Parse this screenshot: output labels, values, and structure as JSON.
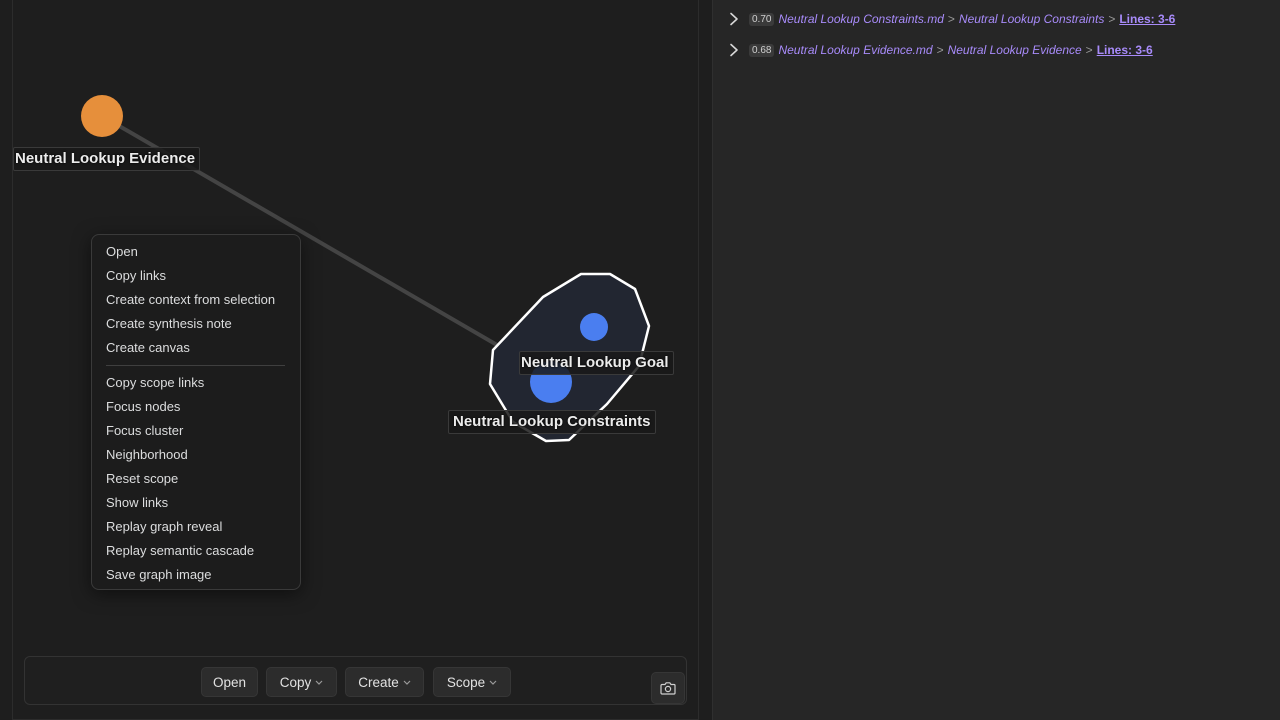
{
  "graph": {
    "nodes": [
      {
        "id": "evidence",
        "label": "Neutral Lookup Evidence",
        "color": "#e68f3b"
      },
      {
        "id": "goal",
        "label": "Neutral Lookup Goal",
        "color": "#4a7ef0"
      },
      {
        "id": "constraints",
        "label": "Neutral Lookup Constraints",
        "color": "#4a7ef0"
      }
    ]
  },
  "context_menu": {
    "group1": [
      "Open",
      "Copy links",
      "Create context from selection",
      "Create synthesis note",
      "Create canvas"
    ],
    "group2": [
      "Copy scope links",
      "Focus nodes",
      "Focus cluster",
      "Neighborhood",
      "Reset scope",
      "Show links",
      "Replay graph reveal",
      "Replay semantic cascade",
      "Save graph image"
    ]
  },
  "toolbar": {
    "open_label": "Open",
    "copy_label": "Copy",
    "create_label": "Create",
    "scope_label": "Scope",
    "camera_icon": "camera-icon"
  },
  "results": [
    {
      "score": "0.70",
      "file": "Neutral Lookup Constraints.md",
      "sep": ">",
      "heading": "Neutral Lookup Constraints",
      "lines": "Lines: 3-6"
    },
    {
      "score": "0.68",
      "file": "Neutral Lookup Evidence.md",
      "sep": ">",
      "heading": "Neutral Lookup Evidence",
      "lines": "Lines: 3-6"
    }
  ],
  "colors": {
    "accent": "#a88bfa",
    "node_orange": "#e68f3b",
    "node_blue": "#4a7ef0"
  }
}
